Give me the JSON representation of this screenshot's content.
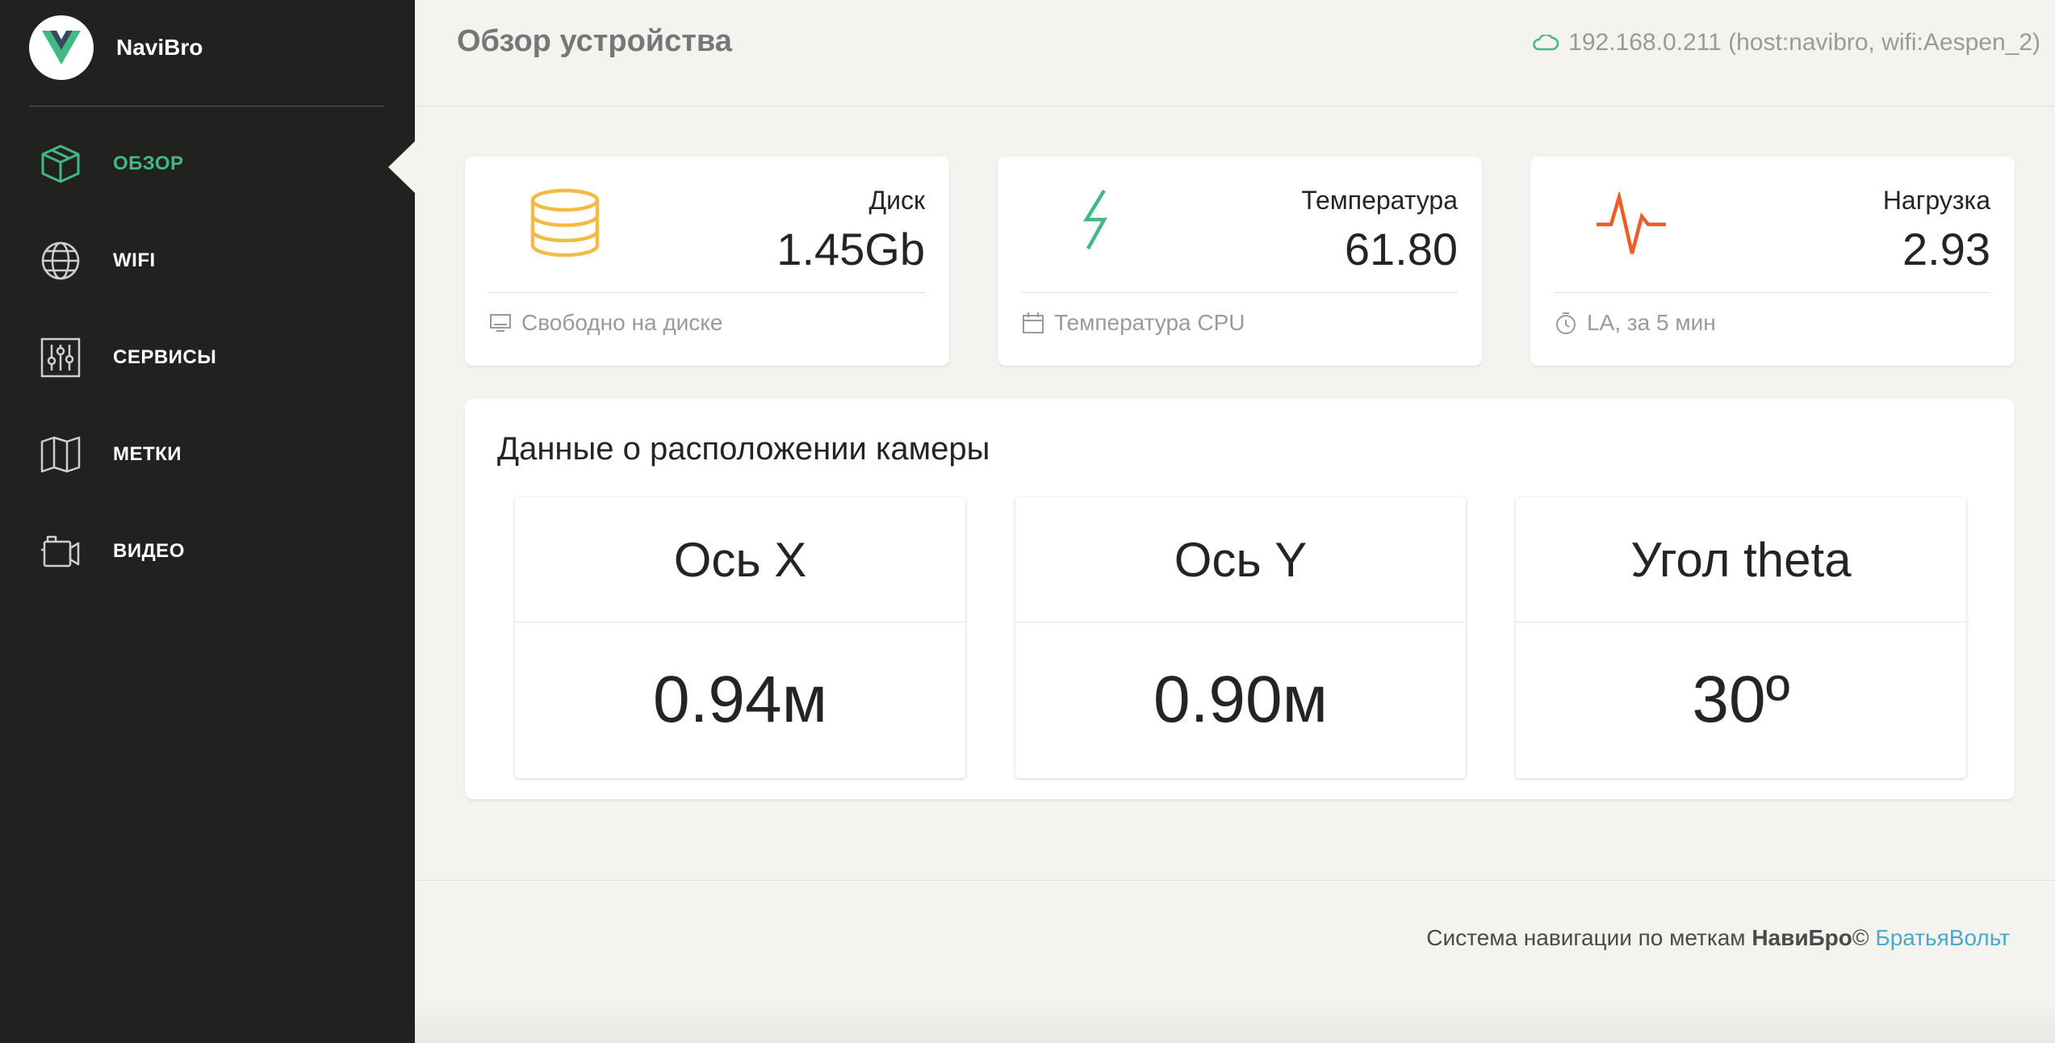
{
  "brand": {
    "name": "NaviBro"
  },
  "sidebar": {
    "items": [
      {
        "label": "ОБЗОР",
        "icon": "box-icon",
        "active": true
      },
      {
        "label": "WIFI",
        "icon": "globe-icon",
        "active": false
      },
      {
        "label": "СЕРВИСЫ",
        "icon": "sliders-icon",
        "active": false
      },
      {
        "label": "МЕТКИ",
        "icon": "map-icon",
        "active": false
      },
      {
        "label": "ВИДЕО",
        "icon": "video-camera-icon",
        "active": false
      }
    ]
  },
  "header": {
    "title": "Обзор устройства",
    "network": "192.168.0.211 (host:navibro, wifi:Aespen_2)"
  },
  "stats": [
    {
      "title": "Диск",
      "value": "1.45Gb",
      "footer": "Свободно на диске",
      "icon": "database-icon",
      "footer_icon": "monitor-icon",
      "color": "#f3bb45"
    },
    {
      "title": "Температура",
      "value": "61.80",
      "footer": "Температура CPU",
      "icon": "lightning-icon",
      "footer_icon": "calendar-icon",
      "color": "#42b983"
    },
    {
      "title": "Нагрузка",
      "value": "2.93",
      "footer": "LA, за 5 мин",
      "icon": "pulse-icon",
      "footer_icon": "timer-icon",
      "color": "#eb5e28"
    }
  ],
  "camera": {
    "title": "Данные о расположении камеры",
    "axes": [
      {
        "label": "Ось X",
        "value": "0.94м"
      },
      {
        "label": "Ось Y",
        "value": "0.90м"
      },
      {
        "label": "Угол theta",
        "value": "30º"
      }
    ]
  },
  "footer": {
    "text": "Система навигации по меткам ",
    "brand": "НавиБро",
    "copyright": "©",
    "link": "БратьяВольт"
  },
  "colors": {
    "accent": "#42b983",
    "sidebar_bg": "#212120",
    "link": "#4aa9c6"
  }
}
